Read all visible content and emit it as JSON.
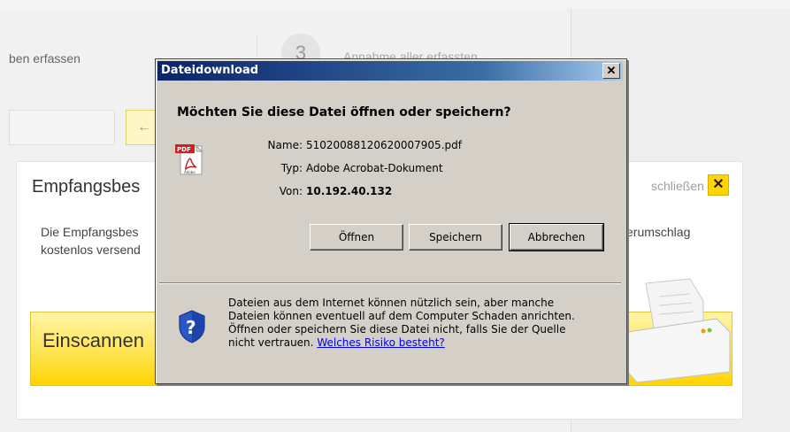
{
  "background": {
    "step_label": "ben erfassen",
    "step_number": "3",
    "step3_label": "Annahme aller erfassten",
    "back_arrow": "←",
    "panel_title": "Empfangsbes",
    "panel_close_label": "schließen",
    "panel_close_x": "✕",
    "desc_line1": "Die Empfangsbes",
    "desc_line2": "kostenlos versend",
    "desc_right": "erumschlag",
    "yellow_label": "Einscannen",
    "accent_color": "#ffd400"
  },
  "dialog": {
    "title": "Dateidownload",
    "close_label": "✕",
    "question": "Möchten Sie diese Datei öffnen oder speichern?",
    "file_icon": "pdf-icon",
    "name_label": "Name:",
    "name_value": "51020088120620007905.pdf",
    "type_label": "Typ:",
    "type_value": "Adobe Acrobat-Dokument",
    "from_label": "Von:",
    "from_value": "10.192.40.132",
    "buttons": {
      "open": "Öffnen",
      "save": "Speichern",
      "cancel": "Abbrechen"
    },
    "warning_icon": "shield-question-icon",
    "warning_lines": [
      "Dateien aus dem Internet können nützlich sein, aber manche",
      "Dateien können eventuell auf dem Computer Schaden anrichten.",
      "Öffnen oder speichern Sie diese Datei nicht, falls Sie der Quelle"
    ],
    "warning_last_prefix": "nicht vertrauen.",
    "warning_link": "Welches Risiko besteht?"
  }
}
